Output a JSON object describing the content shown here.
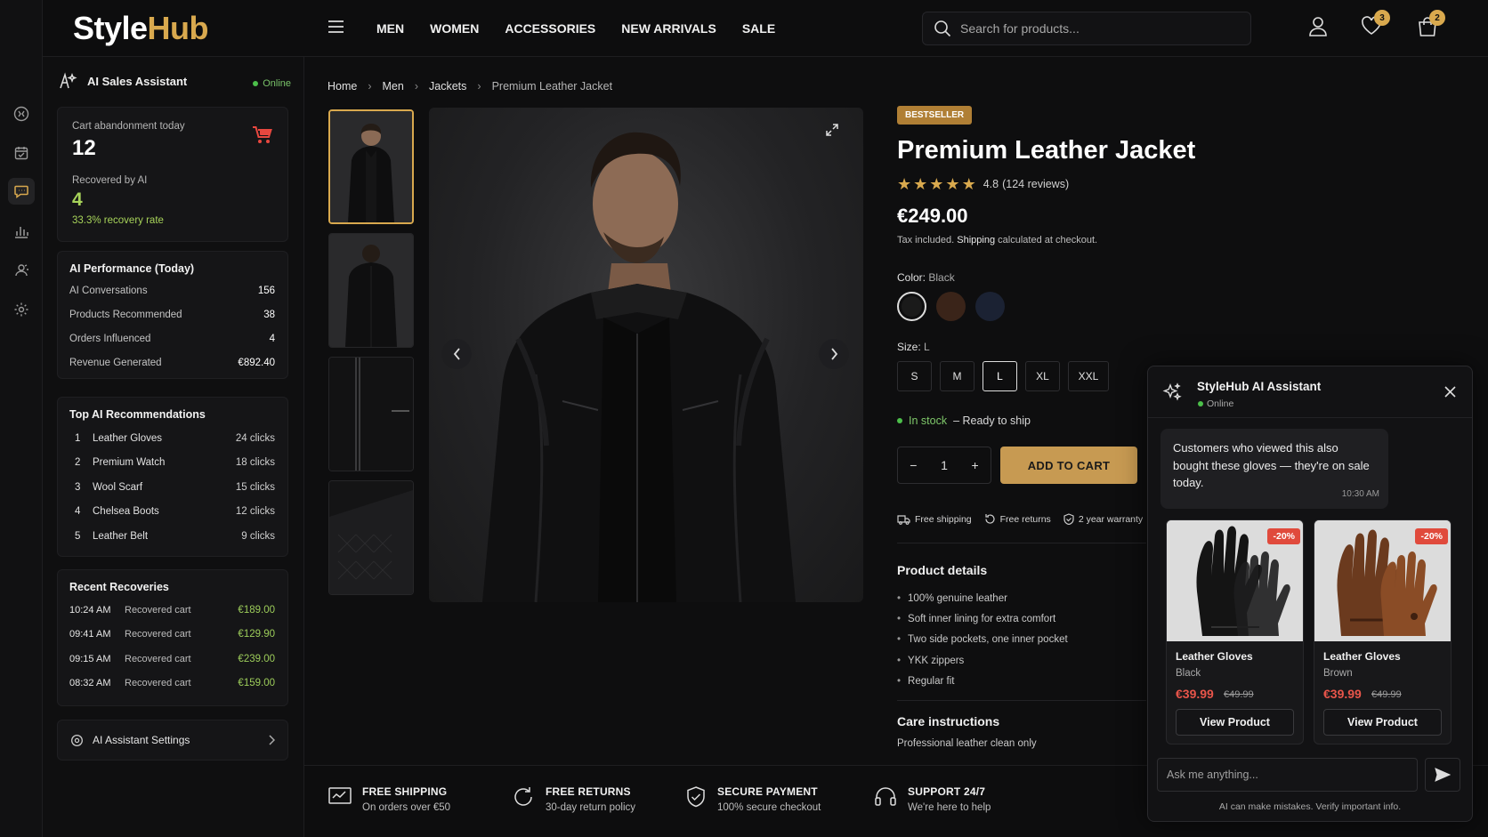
{
  "brand": {
    "part1": "Style",
    "part2": "Hub"
  },
  "nav": [
    "MEN",
    "WOMEN",
    "ACCESSORIES",
    "NEW ARRIVALS",
    "SALE"
  ],
  "search": {
    "placeholder": "Search for products..."
  },
  "header_badges": {
    "wishlist": "3",
    "cart": "2"
  },
  "rail_icons": [
    "dashboard-icon",
    "calendar-icon",
    "chat-icon",
    "analytics-icon",
    "customers-icon",
    "settings-icon"
  ],
  "assistant_panel": {
    "title": "AI Sales Assistant",
    "status": "Online",
    "abandon": {
      "label": "Cart abandonment today",
      "value": "12",
      "recovered_label": "Recovered by AI",
      "recovered_value": "4",
      "rate": "33.3% recovery rate"
    },
    "performance": {
      "title": "AI Performance (Today)",
      "rows": [
        {
          "label": "AI Conversations",
          "value": "156"
        },
        {
          "label": "Products Recommended",
          "value": "38"
        },
        {
          "label": "Orders Influenced",
          "value": "4"
        },
        {
          "label": "Revenue Generated",
          "value": "€892.40"
        }
      ]
    },
    "top_recs": {
      "title": "Top AI Recommendations",
      "rows": [
        {
          "n": "1",
          "name": "Leather Gloves",
          "clicks": "24 clicks"
        },
        {
          "n": "2",
          "name": "Premium Watch",
          "clicks": "18 clicks"
        },
        {
          "n": "3",
          "name": "Wool Scarf",
          "clicks": "15 clicks"
        },
        {
          "n": "4",
          "name": "Chelsea Boots",
          "clicks": "12 clicks"
        },
        {
          "n": "5",
          "name": "Leather Belt",
          "clicks": "9 clicks"
        }
      ]
    },
    "recoveries": {
      "title": "Recent Recoveries",
      "rows": [
        {
          "time": "10:24 AM",
          "desc": "Recovered cart",
          "value": "€189.00"
        },
        {
          "time": "09:41 AM",
          "desc": "Recovered cart",
          "value": "€129.90"
        },
        {
          "time": "09:15 AM",
          "desc": "Recovered cart",
          "value": "€239.00"
        },
        {
          "time": "08:32 AM",
          "desc": "Recovered cart",
          "value": "€159.00"
        }
      ]
    },
    "settings_label": "AI Assistant Settings"
  },
  "breadcrumb": [
    "Home",
    "Men",
    "Jackets",
    "Premium Leather Jacket"
  ],
  "product": {
    "badge": "BESTSELLER",
    "title": "Premium Leather Jacket",
    "rating": "4.8",
    "reviews": "(124 reviews)",
    "stars": 5,
    "price": "€249.00",
    "tax_a": "Tax included.",
    "tax_link": "Shipping",
    "tax_b": "calculated at checkout.",
    "color_label": "Color:",
    "color_value": "Black",
    "colors": [
      "#1a1a1a",
      "#3a2419",
      "#1b2233"
    ],
    "size_label": "Size:",
    "size_value": "L",
    "sizes": [
      "S",
      "M",
      "L",
      "XL",
      "XXL"
    ],
    "stock": "In stock",
    "stock_note": "– Ready to ship",
    "qty": "1",
    "add_to_cart": "ADD TO CART",
    "perks": [
      "Free shipping",
      "Free returns",
      "2 year warranty"
    ],
    "details_title": "Product details",
    "details": [
      "100% genuine leather",
      "Soft inner lining for extra comfort",
      "Two side pockets, one inner pocket",
      "YKK zippers",
      "Regular fit"
    ],
    "care_title": "Care instructions",
    "care_text": "Professional leather clean only"
  },
  "footer": [
    {
      "title": "FREE SHIPPING",
      "sub": "On orders over €50"
    },
    {
      "title": "FREE RETURNS",
      "sub": "30-day return policy"
    },
    {
      "title": "SECURE PAYMENT",
      "sub": "100% secure checkout"
    },
    {
      "title": "SUPPORT 24/7",
      "sub": "We're here to help"
    }
  ],
  "chat": {
    "title": "StyleHub AI Assistant",
    "status": "Online",
    "message": "Customers who viewed this also bought these gloves — they're on sale today.",
    "time": "10:30 AM",
    "products": [
      {
        "name": "Leather Gloves",
        "color": "Black",
        "price": "€39.99",
        "old": "€49.99",
        "discount": "-20%",
        "button": "View Product"
      },
      {
        "name": "Leather Gloves",
        "color": "Brown",
        "price": "€39.99",
        "old": "€49.99",
        "discount": "-20%",
        "button": "View Product"
      }
    ],
    "input_placeholder": "Ask me anything...",
    "disclaimer": "AI can make mistakes. Verify important info."
  }
}
